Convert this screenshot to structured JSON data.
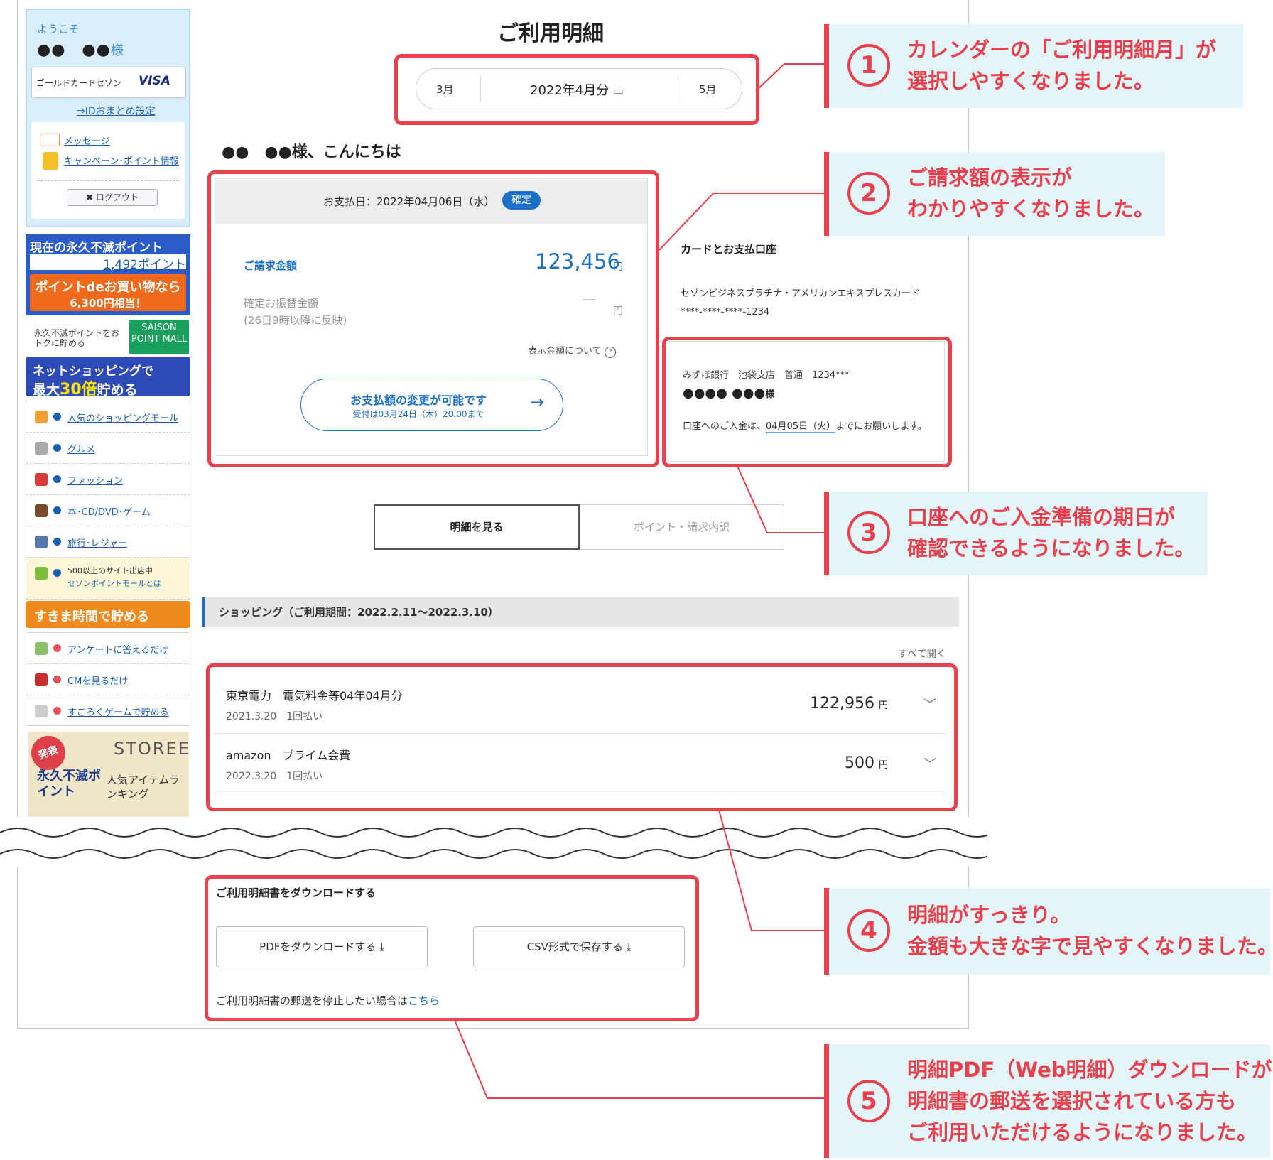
{
  "sidebar": {
    "welcome": "ようこそ",
    "user_name": "●●　●●",
    "user_suffix": "様",
    "card_name": "ゴールドカードセゾン",
    "card_brand": "VISA",
    "id_link": "⇒IDおまとめ設定",
    "message_link": "メッセージ",
    "campaign_link": "キャンペーン･ポイント情報",
    "logout": "ログアウト",
    "points_title": "現在の永久不滅ポイント",
    "points_value": "1,492ポイント",
    "buy_line1": "ポイントdeお買い物なら",
    "buy_line2": "6,300円相当！",
    "mall_text": "永久不滅ポイントをおトクに貯める",
    "mall_logo": "SAISON POINT MALL",
    "netshop_line1": "ネットショッピングで",
    "netshop_prefix": "最大",
    "netshop_mult": "30倍",
    "netshop_suffix": "貯める",
    "categories": [
      {
        "label": "人気のショッピングモール",
        "icon": "shopping-bag-icon"
      },
      {
        "label": "グルメ",
        "icon": "cutlery-icon"
      },
      {
        "label": "ファッション",
        "icon": "shirt-icon"
      },
      {
        "label": "本･CD/DVD･ゲーム",
        "icon": "book-icon"
      },
      {
        "label": "旅行･レジャー",
        "icon": "airplane-icon"
      }
    ],
    "special_line1": "500以上のサイト出店中",
    "special_line2": "セゾンポイントモールとは",
    "sukima": "すきま時間で貯める",
    "sukima_items": [
      "アンケートに答えるだけ",
      "CMを見るだけ",
      "すごろくゲームで貯める"
    ],
    "storee_badge": "発表",
    "storee_logo": "STOREE",
    "storee_title": "永久不滅ポイント",
    "storee_sub": "人気アイテムランキング"
  },
  "main": {
    "title": "ご利用明細",
    "prev_month": "3月",
    "current_month": "2022年4月分",
    "next_month": "5月",
    "greeting": "●●　●●様、こんにちは",
    "pay_date": "お支払日：2022年04月06日（水）",
    "pay_status": "確定",
    "billing_label": "ご請求金額",
    "billing_amount": "123,456",
    "yen": "円",
    "fixed_label_1": "確定お振替金額",
    "fixed_label_2": "(26日9時以降に反映)",
    "fixed_amount": "—",
    "amount_note": "表示金額について",
    "change_line1": "お支払額の変更が可能です",
    "change_line2": "受付は03月24日（木）20:00まで",
    "account_header": "カードとお支払口座",
    "card_full": "セゾンビジネスプラチナ・アメリカンエキスプレスカード",
    "card_number": "****-****-****-1234",
    "bank_info": "みずほ銀行　池袋支店　普通　1234***",
    "bank_holder": "●●●● ●●●",
    "bank_holder_suffix": "様",
    "deposit_prefix": "口座へのご入金は、",
    "deposit_date": "04月05日（火）",
    "deposit_suffix": "までにお願いします。",
    "tab_statement": "明細を見る",
    "tab_points": "ポイント・請求内訳",
    "shopping_header": "ショッピング（ご利用期間：2022.2.11～2022.3.10）",
    "open_all": "すべて開く",
    "items": [
      {
        "name": "東京電力　電気料金等04年04月分",
        "date": "2021.3.20　1回払い",
        "amount": "122,956"
      },
      {
        "name": "amazon　プライム会費",
        "date": "2022.3.20　1回払い",
        "amount": "500"
      }
    ],
    "download_header": "ご利用明細書をダウンロードする",
    "pdf_button": "PDFをダウンロードする",
    "csv_button": "CSV形式で保存する",
    "stop_mail_text": "ご利用明細書の郵送を停止したい場合は",
    "stop_mail_link": "こちら"
  },
  "callouts": [
    {
      "num": "1",
      "line1": "カレンダーの「ご利用明細月」が",
      "line2": "選択しやすくなりました。"
    },
    {
      "num": "2",
      "line1": "ご請求額の表示が",
      "line2": "わかりやすくなりました。"
    },
    {
      "num": "3",
      "line1": "口座へのご入金準備の期日が",
      "line2": "確認できるようになりました。"
    },
    {
      "num": "4",
      "line1": "明細がすっきり。",
      "line2": "金額も大きな字で見やすくなりました。"
    },
    {
      "num": "5",
      "line1": "明細PDF（Web明細）ダウンロードが",
      "line2": "明細書の郵送を選択されている方も",
      "line3": "ご利用いただけるようになりました。"
    }
  ],
  "colors": {
    "annotation_red": "#e8404c",
    "callout_bg": "#e3f5f8",
    "brand_blue": "#1b6fc4"
  }
}
